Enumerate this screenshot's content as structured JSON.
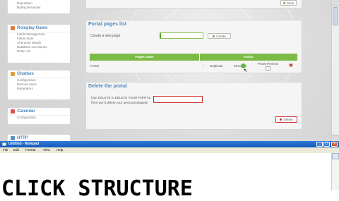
{
  "sidebar": {
    "top_links": [
      "Reputation",
      "Rating Berandas"
    ],
    "roleplay": {
      "title": "Roleplay Game",
      "links": [
        "Fields Management",
        "Fields Style",
        "Character details",
        "Database raw dumps",
        "Enter List"
      ]
    },
    "chatbox": {
      "title": "Chatbox",
      "links": [
        "Configuration",
        "Banned users",
        "Moderators"
      ]
    },
    "calendar": {
      "title": "Calendar",
      "links": [
        "Configuration"
      ]
    },
    "http": {
      "title": "HTTP"
    }
  },
  "main": {
    "save_label": "Save",
    "portal_pages": {
      "title": "Portal pages list",
      "create_label": "Create a new page",
      "create_button": "Create",
      "columns": [
        "Pages name",
        "Action"
      ],
      "row": {
        "name": "Portal",
        "dash": "--",
        "duplicate": "Duplicate",
        "structure": "Structure",
        "preview": "Portal Preview"
      }
    },
    "delete_portal": {
      "title": "Delete the portal",
      "instructions": "Type DELETE to DELETE YOUR PORTAL. Then won't delete your personal widgets!",
      "button": "Delete"
    }
  },
  "notepad": {
    "title": "Untitled - Notepad",
    "menu": [
      "File",
      "Edit",
      "Format",
      "View",
      "Help"
    ],
    "content": "CLICK STRUCTURE"
  },
  "colors": {
    "accent": "#4f86b8",
    "table_header": "#7dbb47",
    "delete_red": "#cc3333"
  }
}
